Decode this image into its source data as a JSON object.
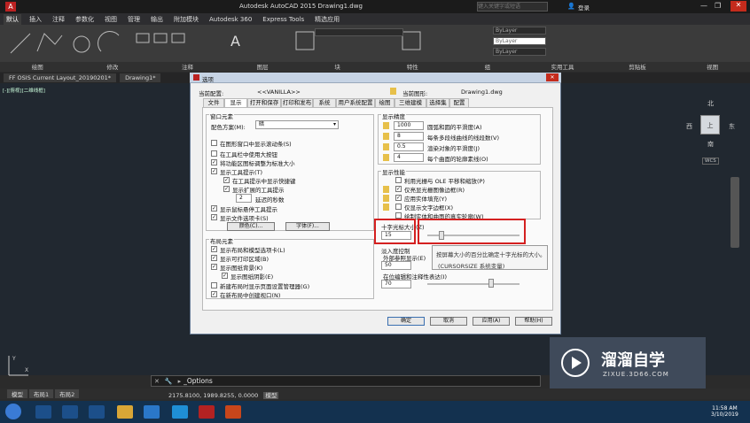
{
  "app": {
    "title": "Autodesk AutoCAD 2015    Drawing1.dwg",
    "search_placeholder": "键入关键字或短语",
    "user_label": "登录"
  },
  "ribbon_tabs": [
    "默认",
    "插入",
    "注释",
    "参数化",
    "视图",
    "管理",
    "输出",
    "附加模块",
    "Autodesk 360",
    "Express Tools",
    "精选应用"
  ],
  "ribbon_panels": [
    "绘图",
    "修改",
    "注释",
    "图层",
    "块",
    "特性",
    "组",
    "实用工具",
    "剪贴板",
    "视图"
  ],
  "ribbon_layer_values": {
    "layer": "ByLayer",
    "linetype": "ByLayer",
    "lineweight": "ByLayer"
  },
  "doc_tabs": [
    "FF OSIS Current Layout_20190201*",
    "Drawing1*"
  ],
  "view_label": "[-][俯视][二维线框]",
  "viewcube": {
    "top": "北",
    "left": "西",
    "right": "东",
    "center": "上",
    "bottom": "南",
    "wcs": "WCS"
  },
  "command": {
    "prompt": "_Options"
  },
  "layout_tabs": [
    "模型",
    "布局1",
    "布局2"
  ],
  "status": {
    "coords": "2175.8100, 1989.8255, 0.0000",
    "mode": "模型"
  },
  "clock": {
    "time": "11:58 AM",
    "date": "3/10/2019"
  },
  "dialog": {
    "title": "选项",
    "current_profile_label": "当前配置:",
    "current_profile_value": "<<VANILLA>>",
    "current_drawing_label": "当前图形:",
    "current_drawing_value": "Drawing1.dwg",
    "tabs": [
      "文件",
      "显示",
      "打开和保存",
      "打印和发布",
      "系统",
      "用户系统配置",
      "绘图",
      "三维建模",
      "选择集",
      "配置"
    ],
    "window_elements": {
      "heading": "窗口元素",
      "color_scheme_label": "配色方案(M):",
      "color_scheme_value": "暗",
      "options": [
        {
          "label": "在图形窗口中显示滚动条(S)",
          "checked": false
        },
        {
          "label": "在工具栏中使用大按钮",
          "checked": false
        },
        {
          "label": "将功能区图标调整为标准大小",
          "checked": true
        },
        {
          "label": "显示工具提示(T)",
          "checked": true
        },
        {
          "label": "在工具提示中显示快捷键",
          "checked": true
        },
        {
          "label": "显示扩展的工具提示",
          "checked": true
        },
        {
          "label": "延迟的秒数",
          "checked": false
        },
        {
          "label": "显示鼠标悬停工具提示",
          "checked": true
        },
        {
          "label": "显示文件选项卡(S)",
          "checked": true
        }
      ],
      "delay_value": "2",
      "colors_button": "颜色(C)...",
      "fonts_button": "字体(F)..."
    },
    "layout_elements": {
      "heading": "布局元素",
      "options": [
        {
          "label": "显示布局和模型选项卡(L)",
          "checked": true
        },
        {
          "label": "显示可打印区域(B)",
          "checked": true
        },
        {
          "label": "显示图纸背景(K)",
          "checked": true
        },
        {
          "label": "显示图纸阴影(E)",
          "checked": true
        },
        {
          "label": "新建布局时显示页面设置管理器(G)",
          "checked": false
        },
        {
          "label": "在新布局中创建视口(N)",
          "checked": true
        }
      ]
    },
    "display_resolution": {
      "heading": "显示精度",
      "items": [
        {
          "value": "1000",
          "label": "圆弧和圆的平滑度(A)"
        },
        {
          "value": "8",
          "label": "每条多段线曲线的线段数(V)"
        },
        {
          "value": "0.5",
          "label": "渲染对象的平滑度(J)"
        },
        {
          "value": "4",
          "label": "每个曲面的轮廓素线(O)"
        }
      ]
    },
    "display_performance": {
      "heading": "显示性能",
      "options": [
        {
          "label": "利用光栅与 OLE 平移和缩放(P)",
          "checked": false
        },
        {
          "label": "仅亮显光栅图像边框(R)",
          "checked": true
        },
        {
          "label": "应用实体填充(Y)",
          "checked": true
        },
        {
          "label": "仅显示文字边框(X)",
          "checked": false
        },
        {
          "label": "绘制实体和曲面的真实轮廓(W)",
          "checked": false
        }
      ]
    },
    "crosshair": {
      "heading": "十字光标大小(Z)",
      "value": "15",
      "fraction": 0.15
    },
    "fade_control": {
      "heading": "淡入度控制",
      "xref_label": "外部参照显示(E)",
      "xref_value": "50",
      "inplace_label": "在位编辑和注释性表达(I)",
      "inplace_value": "70"
    },
    "tooltip": {
      "line1": "按屏幕大小的百分比确定十字光标的大小。",
      "line2": "(CURSORSIZE 系统变量)"
    },
    "buttons": {
      "ok": "确定",
      "cancel": "取消",
      "apply": "应用(A)",
      "help": "帮助(H)"
    }
  },
  "watermark": {
    "title": "溜溜自学",
    "url": "ZIXUE.3D66.COM"
  }
}
